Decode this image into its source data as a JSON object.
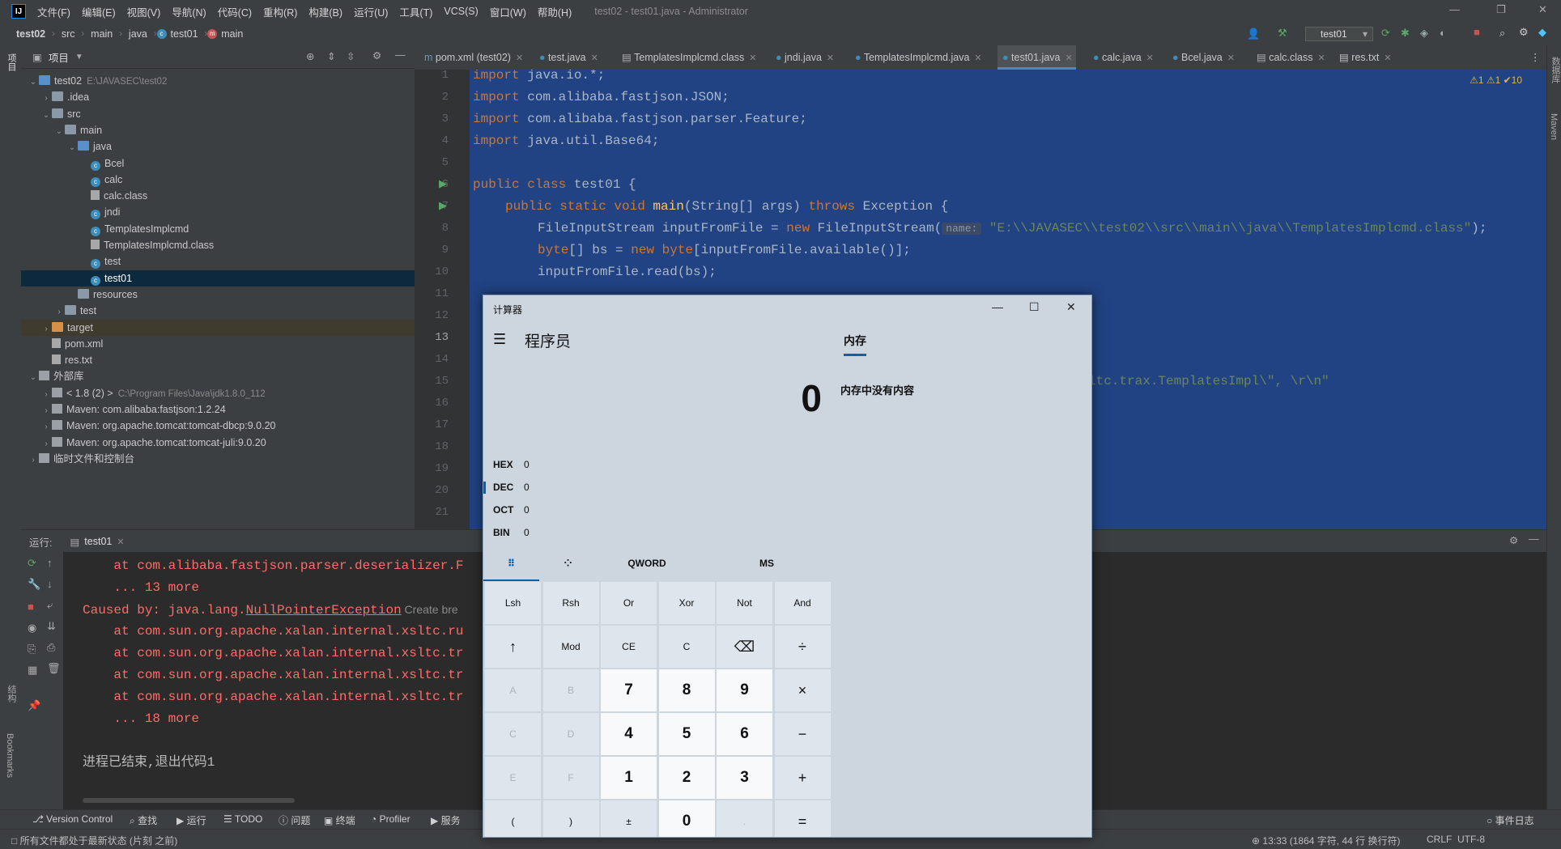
{
  "app": {
    "logo": "IJ",
    "window_title": "test02 - test01.java - Administrator",
    "menu": [
      "文件(F)",
      "编辑(E)",
      "视图(V)",
      "导航(N)",
      "代码(C)",
      "重构(R)",
      "构建(B)",
      "运行(U)",
      "工具(T)",
      "VCS(S)",
      "窗口(W)",
      "帮助(H)"
    ]
  },
  "breadcrumb": [
    "test02",
    "src",
    "main",
    "java",
    "test01",
    "main"
  ],
  "run_config": "test01",
  "left_strip_labels": [
    "项目",
    "结构",
    "Bookmarks"
  ],
  "right_strip_labels": [
    "数据库",
    "Maven"
  ],
  "project": {
    "header": "项目",
    "tree": [
      {
        "label": "test02",
        "hint": "E:\\JAVASEC\\test02",
        "level": 0,
        "arrow": "v",
        "icon": "folder-blue"
      },
      {
        "label": ".idea",
        "level": 1,
        "arrow": ">",
        "icon": "folder"
      },
      {
        "label": "src",
        "level": 1,
        "arrow": "v",
        "icon": "folder"
      },
      {
        "label": "main",
        "level": 2,
        "arrow": "v",
        "icon": "folder"
      },
      {
        "label": "java",
        "level": 3,
        "arrow": "v",
        "icon": "folder-blue"
      },
      {
        "label": "Bcel",
        "level": 4,
        "icon": "class"
      },
      {
        "label": "calc",
        "level": 4,
        "icon": "class"
      },
      {
        "label": "calc.class",
        "level": 4,
        "icon": "file"
      },
      {
        "label": "jndi",
        "level": 4,
        "icon": "class"
      },
      {
        "label": "TemplatesImplcmd",
        "level": 4,
        "icon": "class"
      },
      {
        "label": "TemplatesImplcmd.class",
        "level": 4,
        "icon": "file"
      },
      {
        "label": "test",
        "level": 4,
        "icon": "class"
      },
      {
        "label": "test01",
        "level": 4,
        "icon": "class",
        "selected": true
      },
      {
        "label": "resources",
        "level": 3,
        "icon": "folder"
      },
      {
        "label": "test",
        "level": 2,
        "arrow": ">",
        "icon": "folder"
      },
      {
        "label": "target",
        "level": 1,
        "arrow": ">",
        "icon": "folder-orange",
        "highlight": true
      },
      {
        "label": "pom.xml",
        "level": 1,
        "icon": "file"
      },
      {
        "label": "res.txt",
        "level": 1,
        "icon": "file"
      },
      {
        "label": "外部库",
        "level": 0,
        "arrow": "v",
        "icon": "lib"
      },
      {
        "label": "< 1.8 (2) >",
        "hint": "C:\\Program Files\\Java\\jdk1.8.0_112",
        "level": 1,
        "arrow": ">",
        "icon": "lib"
      },
      {
        "label": "Maven: com.alibaba:fastjson:1.2.24",
        "level": 1,
        "arrow": ">",
        "icon": "lib"
      },
      {
        "label": "Maven: org.apache.tomcat:tomcat-dbcp:9.0.20",
        "level": 1,
        "arrow": ">",
        "icon": "lib"
      },
      {
        "label": "Maven: org.apache.tomcat:tomcat-juli:9.0.20",
        "level": 1,
        "arrow": ">",
        "icon": "lib"
      },
      {
        "label": "临时文件和控制台",
        "level": 0,
        "arrow": ">",
        "icon": "lib"
      }
    ]
  },
  "editor": {
    "tabs": [
      {
        "label": "pom.xml (test02)",
        "icon": "m"
      },
      {
        "label": "test.java",
        "icon": "c"
      },
      {
        "label": "TemplatesImplcmd.class",
        "icon": "f"
      },
      {
        "label": "jndi.java",
        "icon": "c"
      },
      {
        "label": "TemplatesImplcmd.java",
        "icon": "c"
      },
      {
        "label": "test01.java",
        "icon": "c",
        "active": true
      },
      {
        "label": "calc.java",
        "icon": "c"
      },
      {
        "label": "Bcel.java",
        "icon": "c"
      },
      {
        "label": "calc.class",
        "icon": "f"
      },
      {
        "label": "res.txt",
        "icon": "t"
      }
    ],
    "inspection": "⚠1  ⚠1  ✔10",
    "line_numbers": [
      "1",
      "2",
      "3",
      "4",
      "5",
      "6",
      "7",
      "8",
      "9",
      "10",
      "11",
      "12",
      "13",
      "14",
      "15",
      "16",
      "17",
      "18",
      "19",
      "20",
      "21"
    ],
    "current_line": "13",
    "code": {
      "l1_kw": "import",
      "l1_rest": " java.io.*;",
      "l2_kw": "import",
      "l2_rest": " com.alibaba.fastjson.JSON;",
      "l3_kw": "import",
      "l3_rest": " com.alibaba.fastjson.parser.Feature;",
      "l4_kw": "import",
      "l4_rest": " java.util.Base64;",
      "l6_kw": "public class",
      "l6_rest": " test01 {",
      "l7_kw1": "public static void",
      "l7_fn": " main",
      "l7_mid": "(String[] args) ",
      "l7_kw2": "throws",
      "l7_end": " Exception {",
      "l8_a": "FileInputStream inputFromFile = ",
      "l8_kw": "new",
      "l8_b": " FileInputStream(",
      "l8_hint": "name:",
      "l8_str": "\"E:\\\\JAVASEC\\\\test02\\\\src\\\\main\\\\java\\\\TemplatesImplcmd.class\"",
      "l8_end": ");",
      "l9_kw1": "byte",
      "l9_a": "[] bs = ",
      "l9_kw2": "new",
      "l9_kw3": " byte",
      "l9_b": "[inputFromFile.available()];",
      "l10": "inputFromFile.read(bs);",
      "l15_str": "ltc.trax.TemplatesImpl\\\", \\r\\n\""
    }
  },
  "run": {
    "label": "运行:",
    "tab": "test01",
    "console": [
      {
        "text": "    at com.alibaba.fastjson.parser.deserializer.F",
        "cls": "err"
      },
      {
        "text": "    ... 13 more",
        "cls": "err"
      },
      {
        "text": "Caused by: java.lang.NullPointerException",
        "cls": "err"
      },
      {
        "text": "    at com.sun.org.apache.xalan.internal.xsltc.ru",
        "cls": "err"
      },
      {
        "text": "    at com.sun.org.apache.xalan.internal.xsltc.tr",
        "cls": "err"
      },
      {
        "text": "    at com.sun.org.apache.xalan.internal.xsltc.tr",
        "cls": "err"
      },
      {
        "text": "    at com.sun.org.apache.xalan.internal.xsltc.tr",
        "cls": "err"
      },
      {
        "text": "    ... 18 more",
        "cls": "err"
      },
      {
        "text": "",
        "cls": "plain"
      },
      {
        "text": "进程已结束,退出代码1",
        "cls": "plain"
      }
    ],
    "create_breakpoint": "Create bre"
  },
  "tool_windows": [
    "Version Control",
    "查找",
    "运行",
    "TODO",
    "问题",
    "终端",
    "Profiler",
    "服务"
  ],
  "event_log": "事件日志",
  "status": {
    "message": "所有文件都处于最新状态 (片刻 之前)",
    "position": "13:33 (1864 字符, 44 行 换行符)",
    "line_sep": "CRLF",
    "encoding": "UTF-8"
  },
  "calculator": {
    "title": "计算器",
    "mode": "程序员",
    "memory_tab": "内存",
    "memory_empty": "内存中没有内容",
    "display": "0",
    "radix": [
      {
        "label": "HEX",
        "value": "0"
      },
      {
        "label": "DEC",
        "value": "0",
        "active": true
      },
      {
        "label": "OCT",
        "value": "0"
      },
      {
        "label": "BIN",
        "value": "0"
      }
    ],
    "word_size": "QWORD",
    "memory_store": "MS",
    "keys": [
      [
        "Lsh",
        "Rsh",
        "Or",
        "Xor",
        "Not",
        "And"
      ],
      [
        "↑",
        "Mod",
        "CE",
        "C",
        "⌫",
        "÷"
      ],
      [
        "A",
        "B",
        "7",
        "8",
        "9",
        "×"
      ],
      [
        "C",
        "D",
        "4",
        "5",
        "6",
        "−"
      ],
      [
        "E",
        "F",
        "1",
        "2",
        "3",
        "+"
      ],
      [
        "(",
        ")",
        "±",
        "0",
        ".",
        "="
      ]
    ]
  }
}
